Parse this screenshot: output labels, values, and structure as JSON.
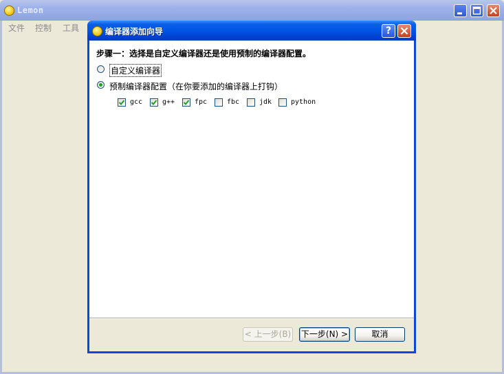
{
  "main_window": {
    "title": "Lemon",
    "menu": [
      "文件",
      "控制",
      "工具"
    ]
  },
  "dialog": {
    "title": "编译器添加向导",
    "help_label": "?",
    "step_heading": "步骤一：选择是自定义编译器还是使用预制的编译器配置。",
    "radio_custom": {
      "label": "自定义编译器",
      "checked": false
    },
    "radio_preset": {
      "label": "预制编译器配置（在你要添加的编译器上打钩）",
      "checked": true
    },
    "compilers": [
      {
        "label": "gcc",
        "checked": true
      },
      {
        "label": "g++",
        "checked": true
      },
      {
        "label": "fpc",
        "checked": true
      },
      {
        "label": "fbc",
        "checked": false
      },
      {
        "label": "jdk",
        "checked": false
      },
      {
        "label": "python",
        "checked": false
      }
    ],
    "buttons": {
      "back": "< 上一步(B)",
      "next": "下一步(N) >",
      "cancel": "取消"
    }
  },
  "colors": {
    "dialog_title_blue": "#0055e5",
    "checkmark_green": "#21a121",
    "window_bg": "#ece9d8"
  }
}
